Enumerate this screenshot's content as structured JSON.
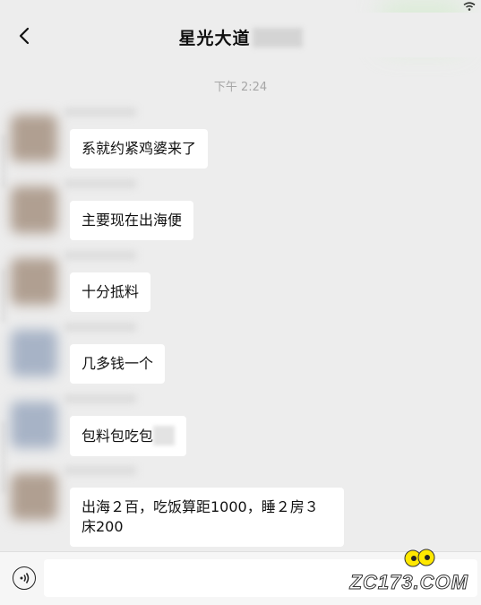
{
  "header": {
    "title": "星光大道",
    "back_icon": "chevron-left-icon"
  },
  "timestamp": "下午 2:24",
  "messages": [
    {
      "text": "系就约紧鸡婆来了",
      "avatar": "brown"
    },
    {
      "text": "主要现在出海便",
      "avatar": "brown"
    },
    {
      "text": "十分抵料",
      "avatar": "brown"
    },
    {
      "text": "几多钱一个",
      "avatar": "blue"
    },
    {
      "text": "包料包吃包",
      "avatar": "blue"
    },
    {
      "text": "出海２百，吃饭算距1000，睡２房３床200",
      "avatar": "brown"
    }
  ],
  "input_bar": {
    "voice_icon": "voice-icon",
    "value": ""
  },
  "watermark": "ZC173.COM",
  "colors": {
    "background": "#ededed",
    "bubble": "#ffffff",
    "timestamp": "#a6a6a6"
  }
}
